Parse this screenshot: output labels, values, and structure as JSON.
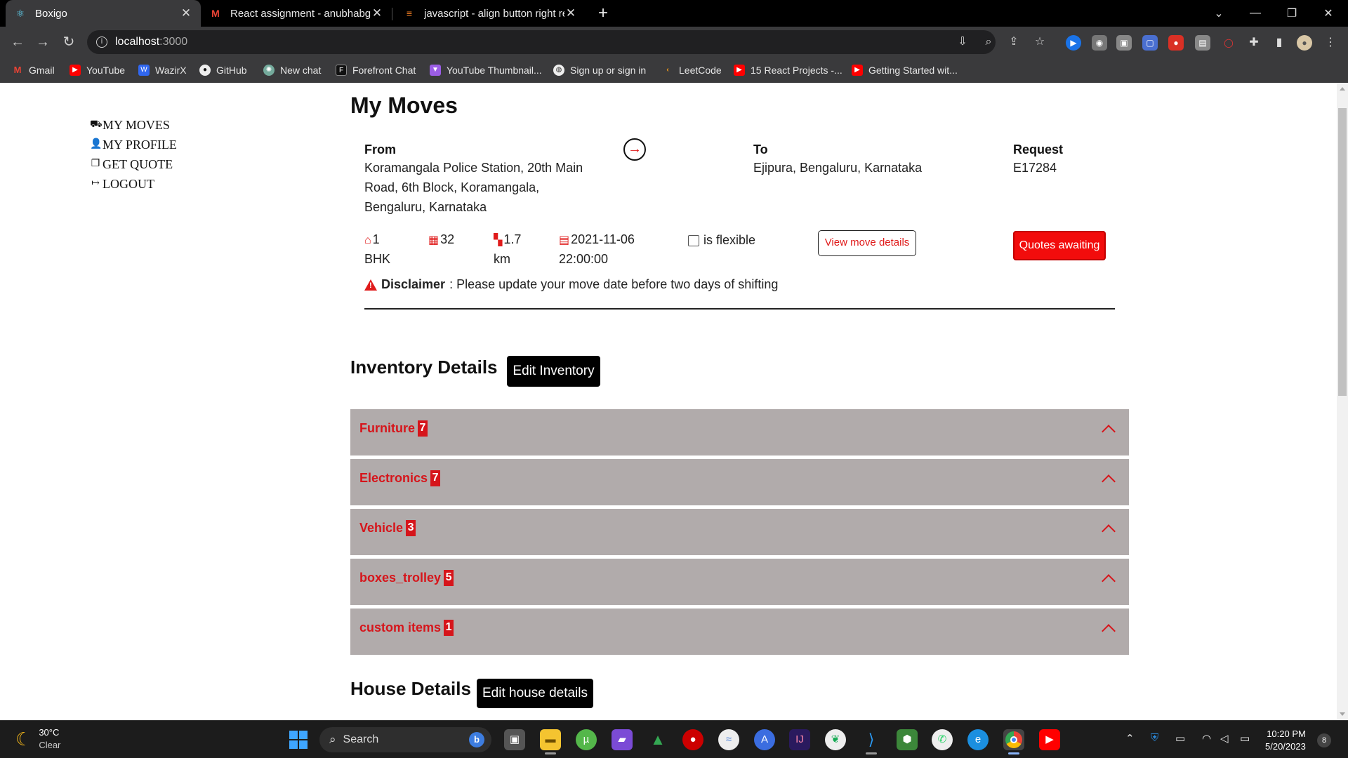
{
  "browser": {
    "tabs": [
      {
        "title": "Boxigo",
        "icon": "react-icon"
      },
      {
        "title": "React assignment - anubhabguha",
        "icon": "gmail-icon"
      },
      {
        "title": "javascript - align button right rea",
        "icon": "stackoverflow-icon"
      }
    ],
    "url_host": "localhost",
    "url_port": ":3000",
    "bookmarks": [
      "Gmail",
      "YouTube",
      "WazirX",
      "GitHub",
      "New chat",
      "Forefront Chat",
      "YouTube Thumbnail...",
      "Sign up or sign in",
      "LeetCode",
      "15 React Projects -...",
      "Getting Started wit..."
    ]
  },
  "sidebar": {
    "items": [
      "MY MOVES",
      "MY PROFILE",
      "GET QUOTE",
      "LOGOUT"
    ]
  },
  "move": {
    "page_title": "My Moves",
    "from_label": "From",
    "from_lines": [
      "Koramangala Police Station, 20th Main",
      "Road, 6th Block, Koramangala,",
      "Bengaluru, Karnataka"
    ],
    "to_label": "To",
    "to_value": "Ejipura, Bengaluru, Karnataka",
    "request_label": "Request",
    "request_value": "E17284",
    "house_size_top": "1",
    "house_size_bottom": "BHK",
    "items_count": "32",
    "distance_top": "1.7",
    "distance_bottom": "km",
    "date_top": "2021-11-06",
    "date_bottom": "22:00:00",
    "flexible_label": "is flexible",
    "view_details_label": "View move details",
    "quotes_label": "Quotes awaiting",
    "disclaimer_bold": "Disclaimer",
    "disclaimer_text": ": Please update your move date before two days of shifting"
  },
  "inventory": {
    "title": "Inventory Details",
    "edit_label": "Edit Inventory",
    "categories": [
      {
        "name": "Furniture",
        "count": "7"
      },
      {
        "name": "Electronics",
        "count": "7"
      },
      {
        "name": "Vehicle",
        "count": "3"
      },
      {
        "name": "boxes_trolley",
        "count": "5"
      },
      {
        "name": "custom items",
        "count": "1"
      }
    ]
  },
  "house": {
    "title": "House Details",
    "edit_label": "Edit house details"
  },
  "taskbar": {
    "temperature": "30°C",
    "weather": "Clear",
    "search_placeholder": "Search",
    "time": "10:20 PM",
    "date": "5/20/2023",
    "notification_count": "8"
  }
}
